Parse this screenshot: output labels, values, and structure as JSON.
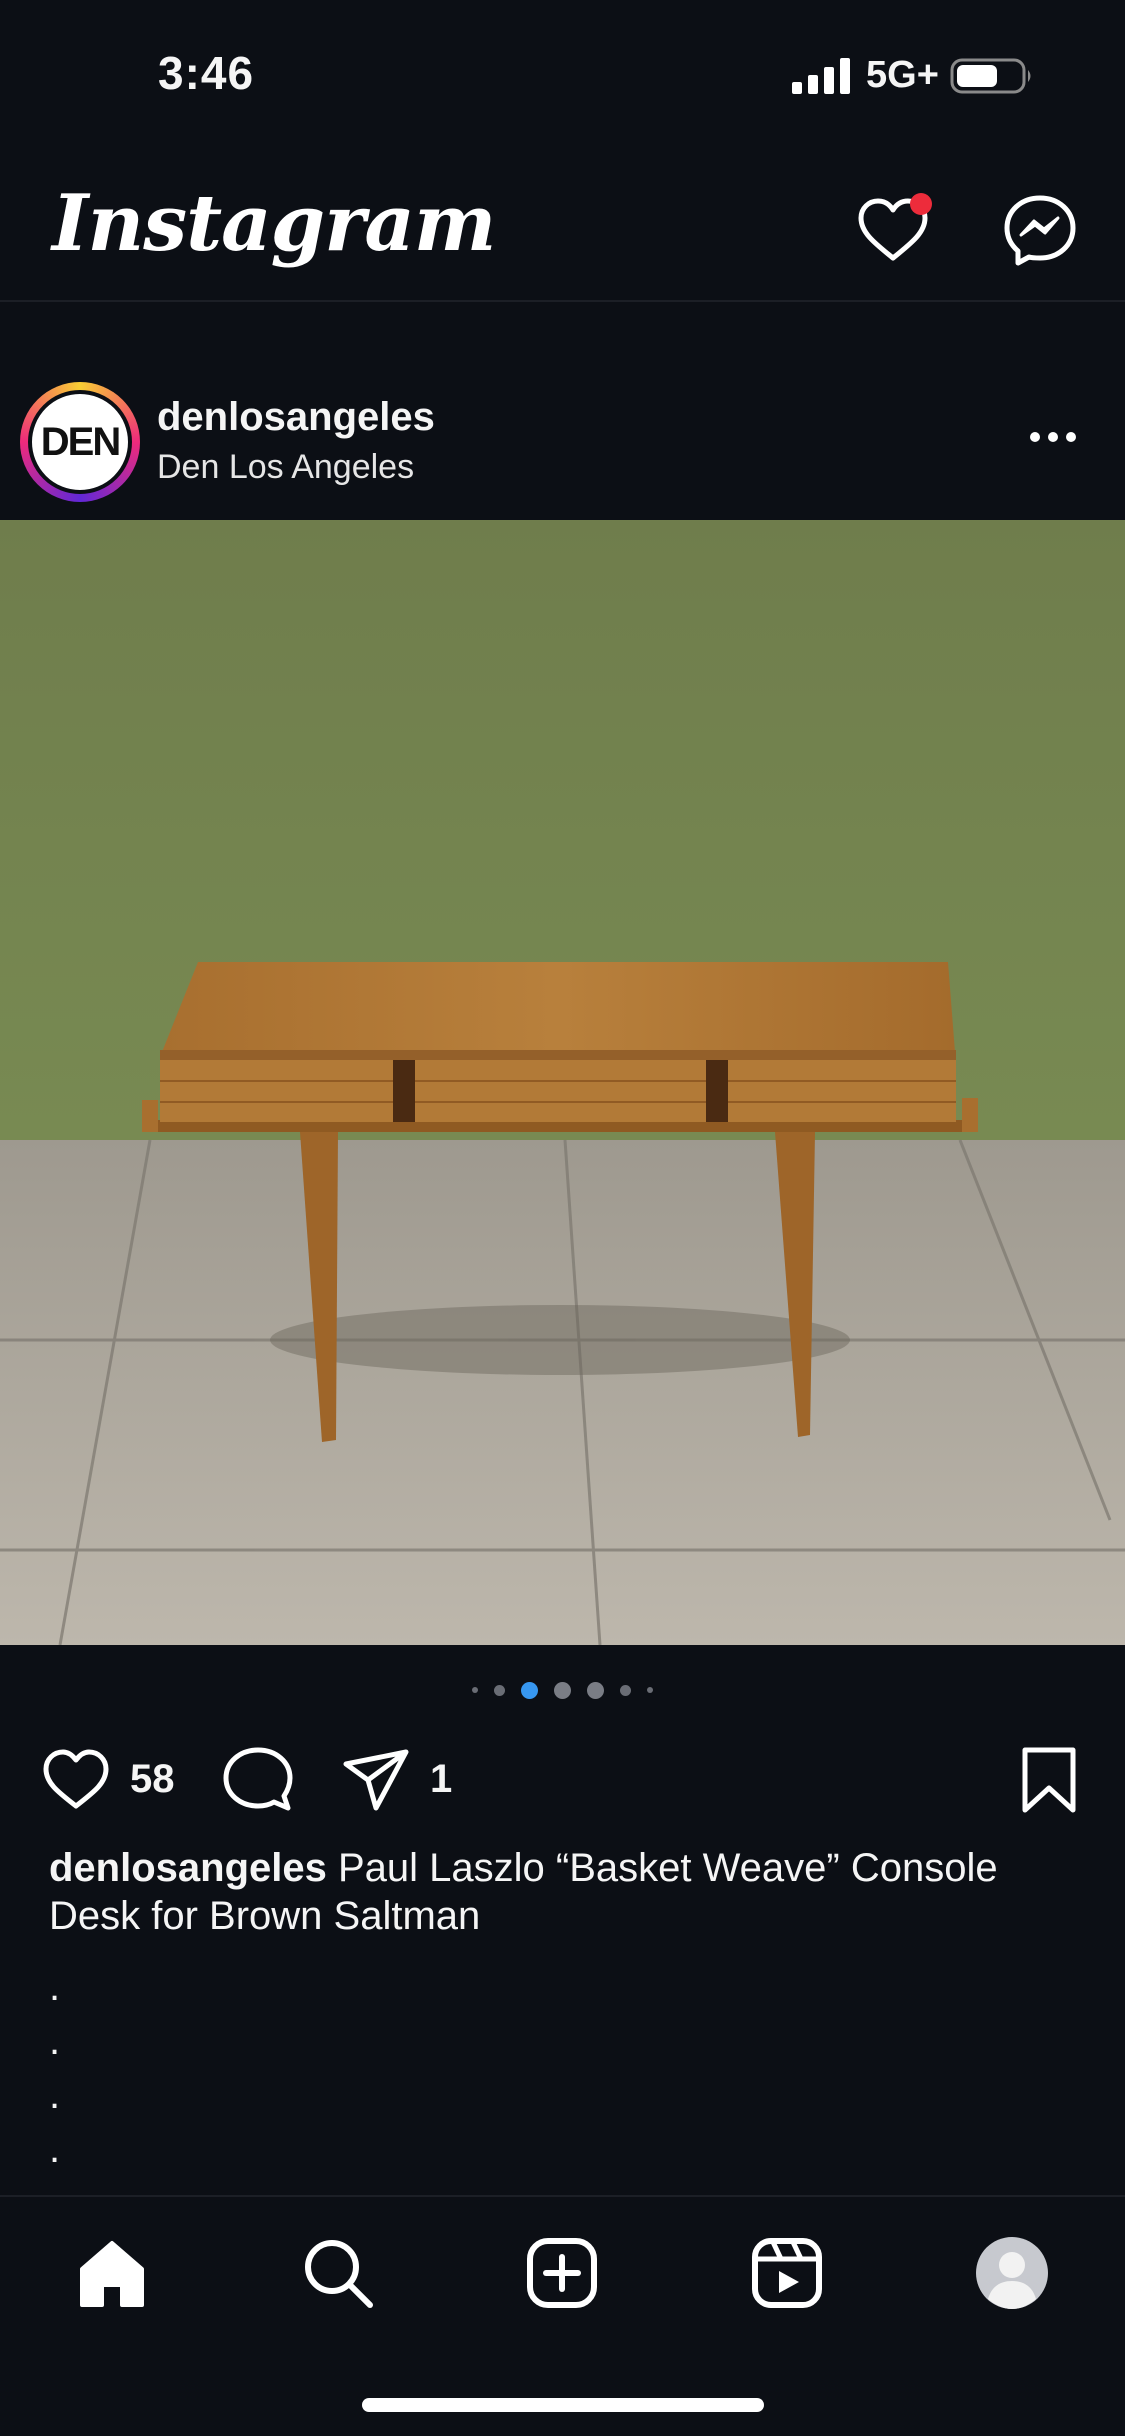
{
  "status_bar": {
    "time": "3:46",
    "network": "5G+"
  },
  "header": {
    "title": "Instagram",
    "icons": [
      "heart-icon",
      "messenger-icon"
    ],
    "notification_color": "#ed2c3b"
  },
  "post": {
    "username": "denlosangeles",
    "subtitle": "Den Los Angeles",
    "avatar_text": "DEN",
    "carousel": {
      "total": 7,
      "active": 2,
      "accent": "#3797f0"
    },
    "likes": "58",
    "shares": "1",
    "caption": {
      "username": "denlosangeles",
      "text": " Paul Laszlo “Basket Weave” Console Desk for Brown Saltman"
    },
    "caption_dots": [
      ".",
      ".",
      ".",
      "."
    ]
  },
  "bottom_nav": {
    "items": [
      "home-icon",
      "search-icon",
      "create-icon",
      "reels-icon",
      "profile-icon"
    ],
    "active": "home"
  }
}
